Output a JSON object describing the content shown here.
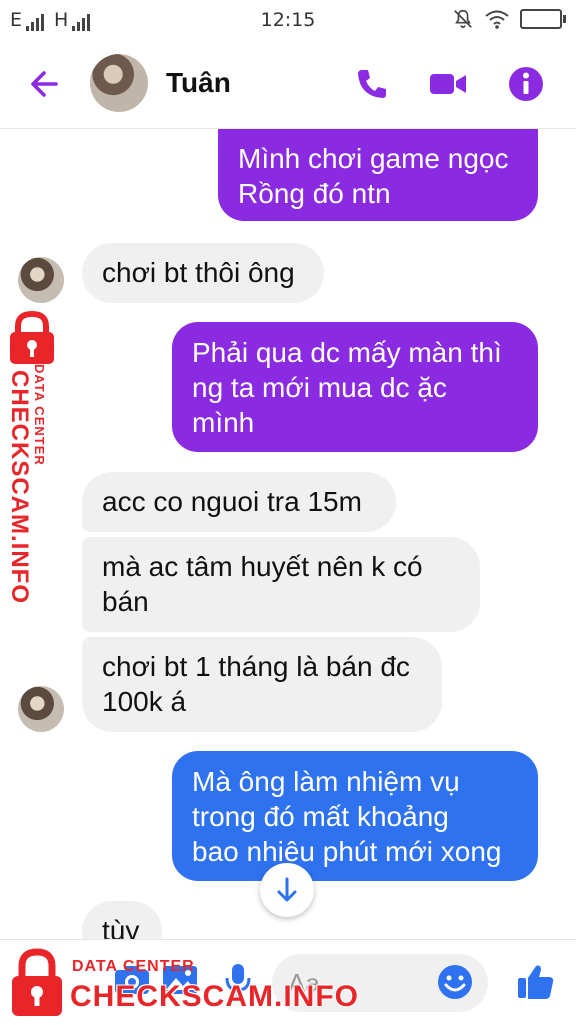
{
  "status_bar": {
    "sim1": "E",
    "sim2": "H",
    "time": "12:15"
  },
  "header": {
    "contact_name": "Tuân",
    "accent": "#8a2be2",
    "icons": [
      "back-arrow-icon",
      "phone-icon",
      "video-camera-icon",
      "info-icon"
    ]
  },
  "messages": [
    {
      "side": "out",
      "text": "Mình chơi game ngọc\nRồng đó ntn"
    },
    {
      "side": "in",
      "text": "chơi bt thôi ông"
    },
    {
      "side": "out",
      "text": "Phải qua dc mấy màn thì\nng ta mới mua dc ặc\nmình"
    },
    {
      "side": "in",
      "text": "acc co nguoi tra 15m"
    },
    {
      "side": "in",
      "text": "mà ac tâm huyết nên k có\nbán"
    },
    {
      "side": "in",
      "text": "chơi bt 1 tháng là bán đc\n100k á"
    },
    {
      "side": "out",
      "text": "Mà ông làm nhiệm vụ\ntrong đó mất khoảng\nbao nhiêu phút mới xong"
    },
    {
      "side": "in",
      "text": "tùy"
    }
  ],
  "composer": {
    "placeholder": "Aa",
    "icons": [
      "camera-icon",
      "image-icon",
      "microphone-icon",
      "emoji-icon",
      "like-icon"
    ]
  },
  "watermark": {
    "data_center": "DATA CENTER",
    "brand": "CHECKSCAM.INFO",
    "brand_color": "#e8262a"
  }
}
